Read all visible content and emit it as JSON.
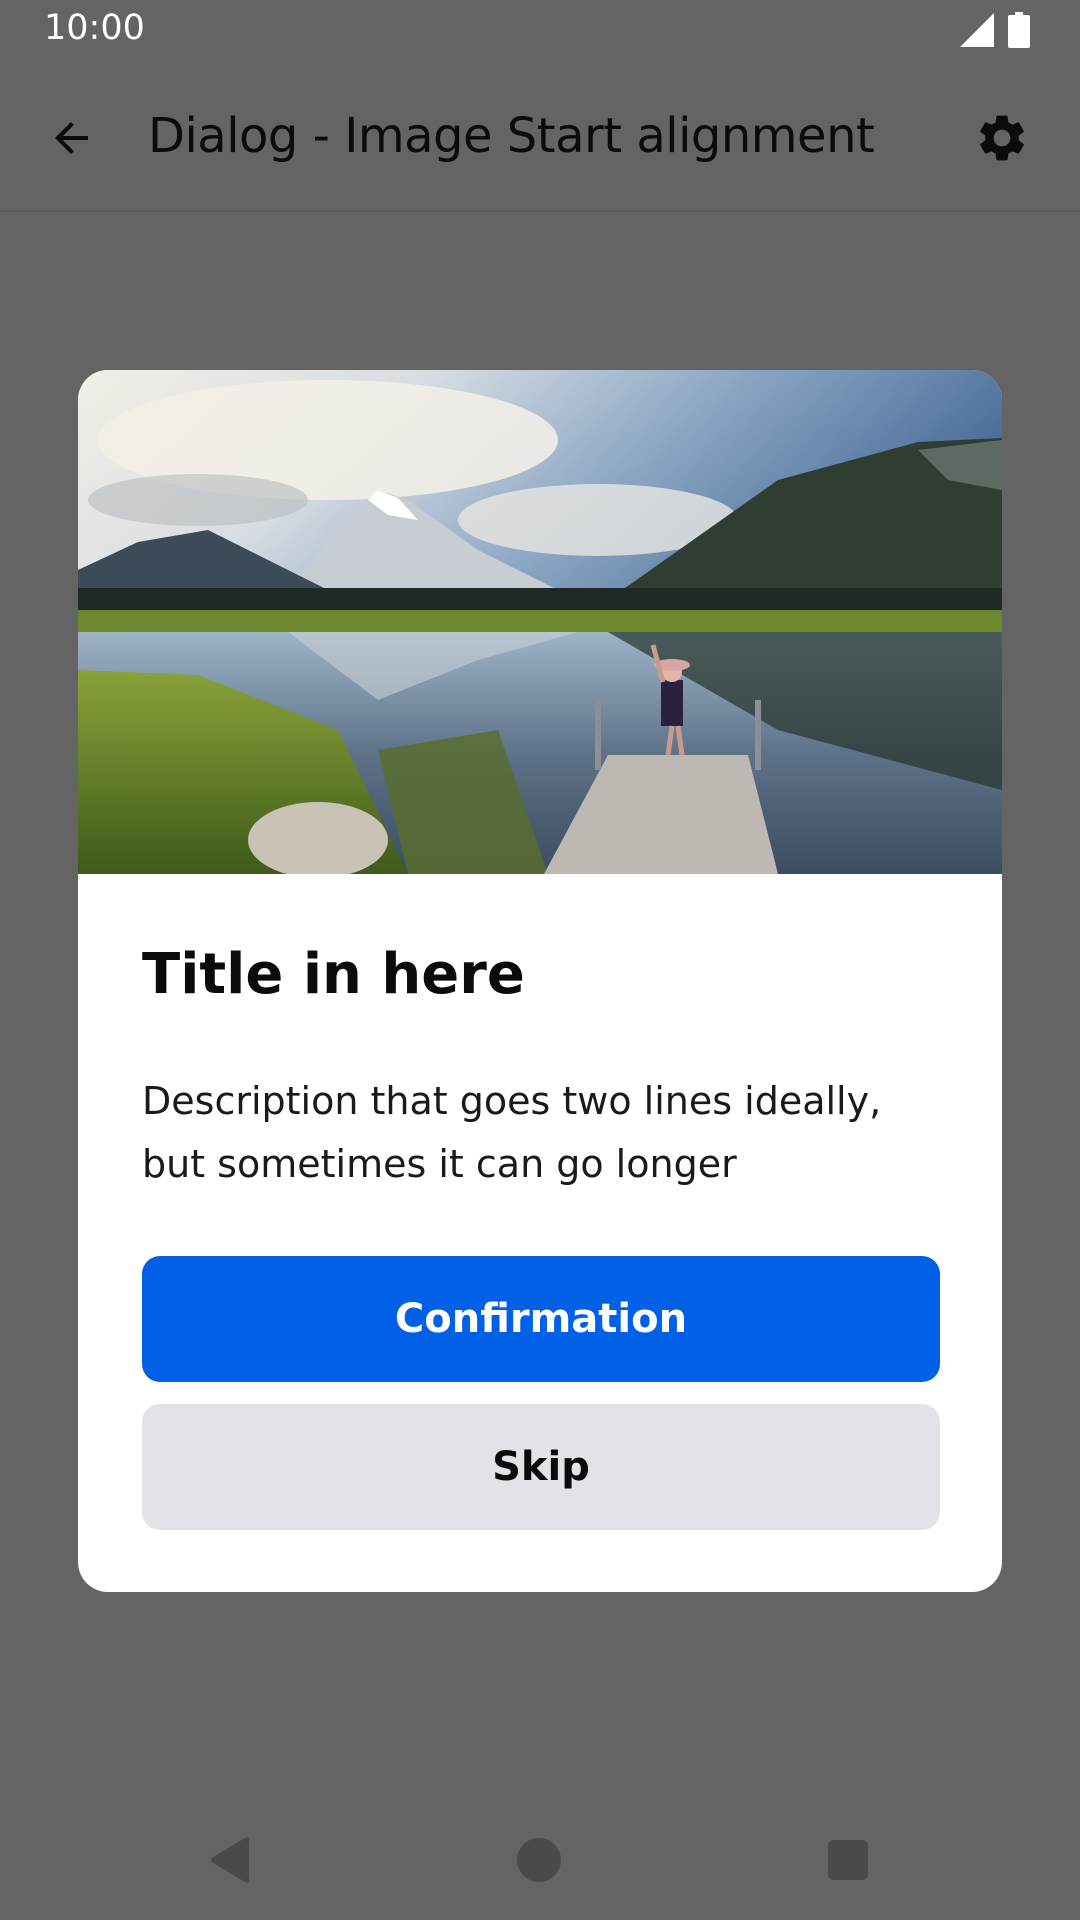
{
  "status_bar": {
    "time": "10:00",
    "icons": [
      "cell-signal-icon",
      "battery-icon"
    ]
  },
  "toolbar": {
    "back_icon": "arrow-left-icon",
    "title": "Dialog - Image Start alignment",
    "settings_icon": "gear-icon"
  },
  "dialog": {
    "image_alt": "lake-landscape-image",
    "title": "Title in here",
    "description": "Description that goes two lines ideally, but sometimes it can go longer",
    "primary_button": "Confirmation",
    "secondary_button": "Skip"
  },
  "nav_bar": {
    "icons": [
      "nav-back-icon",
      "nav-home-icon",
      "nav-recents-icon"
    ]
  },
  "colors": {
    "scrim": "#646464",
    "primary": "#0061e6",
    "secondary_button_bg": "#e1e3e8",
    "surface": "#ffffff"
  }
}
